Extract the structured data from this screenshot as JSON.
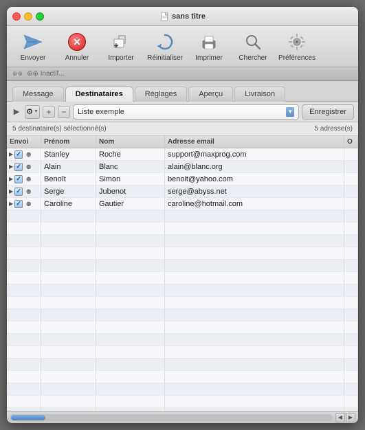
{
  "window": {
    "title": "sans titre"
  },
  "toolbar": {
    "items": [
      {
        "id": "envoyer",
        "label": "Envoyer"
      },
      {
        "id": "annuler",
        "label": "Annuler"
      },
      {
        "id": "importer",
        "label": "Importer"
      },
      {
        "id": "reinitialiser",
        "label": "Réinitialiser"
      },
      {
        "id": "imprimer",
        "label": "Imprimer"
      },
      {
        "id": "chercher",
        "label": "Chercher"
      },
      {
        "id": "preferences",
        "label": "Préférences"
      }
    ]
  },
  "statusbar": {
    "text": "⊕⊕ Inactif..."
  },
  "tabs": [
    {
      "id": "message",
      "label": "Message"
    },
    {
      "id": "destinataires",
      "label": "Destinataires",
      "active": true
    },
    {
      "id": "reglages",
      "label": "Réglages"
    },
    {
      "id": "apercu",
      "label": "Aperçu"
    },
    {
      "id": "livraison",
      "label": "Livraison"
    }
  ],
  "listtoolbar": {
    "list_name": "Liste exemple",
    "save_label": "Enregistrer",
    "plus_label": "+",
    "minus_label": "−"
  },
  "infobar": {
    "selected": "5 destinataire(s) sélectionné(s)",
    "count": "5 adresse(s)"
  },
  "table": {
    "headers": [
      "Envoi",
      "Prénom",
      "Nom",
      "Adresse email",
      "O"
    ],
    "rows": [
      {
        "checked": true,
        "prenom": "Stanley",
        "nom": "Roche",
        "email": "support@maxprog.com"
      },
      {
        "checked": true,
        "prenom": "Alain",
        "nom": "Blanc",
        "email": "alain@blanc.org"
      },
      {
        "checked": true,
        "prenom": "Benoît",
        "nom": "Simon",
        "email": "benoit@yahoo.com"
      },
      {
        "checked": true,
        "prenom": "Serge",
        "nom": "Jubenot",
        "email": "serge@abyss.net"
      },
      {
        "checked": true,
        "prenom": "Caroline",
        "nom": "Gautier",
        "email": "caroline@hotmail.com"
      }
    ]
  }
}
